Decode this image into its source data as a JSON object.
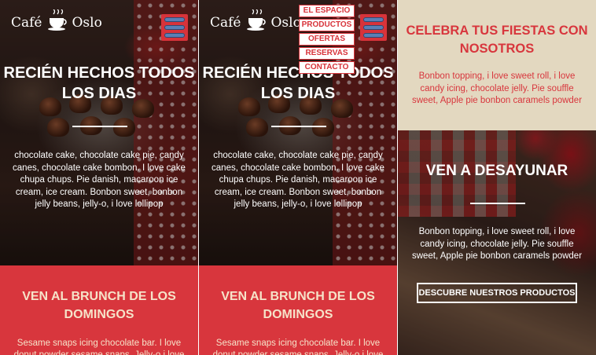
{
  "brand": {
    "name_left": "Café",
    "name_right": "Oslo",
    "logo_icon": "coffee-cup-icon",
    "accent_color": "#d8363d",
    "cream_color": "#f6e3c9",
    "beige_color": "#e3d8c0"
  },
  "hero": {
    "title": "RECIÉN HECHOS TODOS LOS DIAS",
    "text": "chocolate cake, chocolate cake pie, candy canes, chocolate cake bombon. I love cake chupa chups. Pie danish, macaroon ice cream, ice cream. Bonbon sweet, bonbon jelly beans, jelly-o, i love lollipop"
  },
  "brunch": {
    "title": "VEN AL BRUNCH DE LOS DOMINGOS",
    "text": "Sesame snaps icing chocolate bar. I love donut powder sesame snaps. Jelly-o i love"
  },
  "menu": {
    "toggle_icon": "hamburger-menu-icon",
    "items": [
      {
        "label": "EL ESPACIO"
      },
      {
        "label": "PRODUCTOS"
      },
      {
        "label": "OFERTAS"
      },
      {
        "label": "RESERVAS"
      },
      {
        "label": "CONTACTO"
      }
    ]
  },
  "fiestas": {
    "title": "CELEBRA TUS FIESTAS CON NOSOTROS",
    "text": "Bonbon topping, i love sweet roll, i love candy icing, chocolate jelly. Pie souffle sweet, Apple pie bonbon caramels powder"
  },
  "desayuno": {
    "title": "VEN A DESAYUNAR",
    "text": "Bonbon topping, i love sweet roll, i love candy icing, chocolate jelly. Pie souffle sweet, Apple pie bonbon caramels powder",
    "cta_label": "DESCUBRE NUESTROS PRODUCTOS"
  }
}
